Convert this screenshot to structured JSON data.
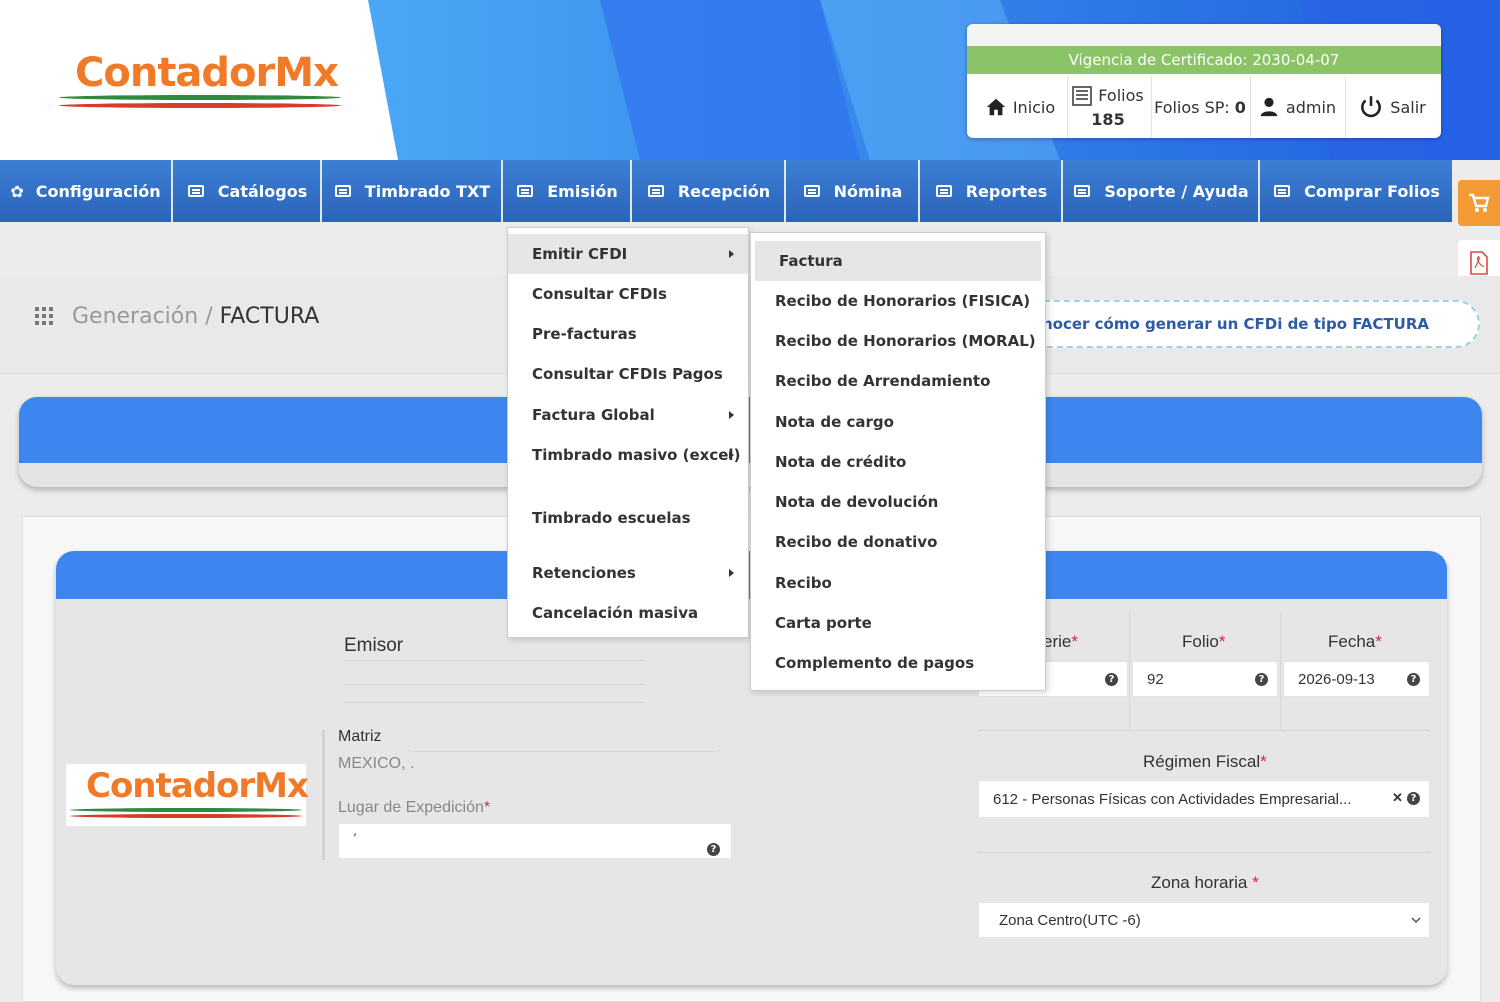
{
  "brand": {
    "logo_text": "ContadorMx"
  },
  "userbox": {
    "certificate": "Vigencia de Certificado: 2030-04-07",
    "inicio": "Inicio",
    "folios_label": "Folios",
    "folios_count": "185",
    "folios_sp_label": "Folios SP:",
    "folios_sp_value": "0",
    "user": "admin",
    "logout": "Salir"
  },
  "nav": {
    "items": [
      {
        "label": "Configuración",
        "icon": "gear-icon"
      },
      {
        "label": "Catálogos",
        "icon": "list-icon"
      },
      {
        "label": "Timbrado TXT",
        "icon": "list-icon"
      },
      {
        "label": "Emisión",
        "icon": "list-icon"
      },
      {
        "label": "Recepción",
        "icon": "list-icon"
      },
      {
        "label": "Nómina",
        "icon": "list-icon"
      },
      {
        "label": "Reportes",
        "icon": "list-icon"
      },
      {
        "label": "Soporte / Ayuda",
        "icon": "list-icon"
      },
      {
        "label": "Comprar Folios",
        "icon": "card-icon"
      }
    ]
  },
  "breadcrumb": {
    "parent": "Generación",
    "separator": "/",
    "current": "FACTURA"
  },
  "help_link": "nocer cómo generar un CFDi de tipo FACTURA",
  "emision_menu": {
    "items": [
      {
        "label": "Emitir CFDI",
        "has_submenu": true,
        "highlighted": true
      },
      {
        "label": "Consultar CFDIs"
      },
      {
        "label": "Pre-facturas"
      },
      {
        "label": "Consultar CFDIs Pagos"
      },
      {
        "label": "Factura Global",
        "has_submenu": true
      },
      {
        "label": "Timbrado masivo (excel)",
        "has_submenu": true
      },
      {
        "label": "Timbrado escuelas"
      },
      {
        "label": "Retenciones",
        "has_submenu": true
      },
      {
        "label": "Cancelación masiva"
      }
    ]
  },
  "emitir_submenu": {
    "items": [
      {
        "label": "Factura",
        "highlighted": true
      },
      {
        "label": "Recibo de Honorarios (FISICA)"
      },
      {
        "label": "Recibo de Honorarios (MORAL)"
      },
      {
        "label": "Recibo de Arrendamiento"
      },
      {
        "label": "Nota de cargo"
      },
      {
        "label": "Nota de crédito"
      },
      {
        "label": "Nota de devolución"
      },
      {
        "label": "Recibo de donativo"
      },
      {
        "label": "Recibo"
      },
      {
        "label": "Carta porte"
      },
      {
        "label": "Complemento de pagos"
      }
    ]
  },
  "emisor": {
    "title": "Emisor",
    "matriz": "Matriz",
    "address": "MEXICO, .",
    "lugar_label": "Lugar de Expedición",
    "lugar_value": "‘"
  },
  "form": {
    "serie_label": "erie",
    "serie_value": "",
    "folio_label": "Folio",
    "folio_value": "92",
    "fecha_label": "Fecha",
    "fecha_value": "2026-09-13",
    "regimen_label": "Régimen Fiscal",
    "regimen_value": "612 - Personas Físicas con Actividades Empresarial...",
    "zona_label": "Zona horaria",
    "zona_value": "Zona Centro(UTC -6)",
    "required_mark": "*"
  },
  "colors": {
    "nav_blue": "#2a64b8",
    "panel_blue": "#3d86f0",
    "brand_orange": "#f07a28",
    "cert_green": "#8bc467",
    "cart_orange": "#f39a34",
    "required_red": "#d9263a"
  }
}
